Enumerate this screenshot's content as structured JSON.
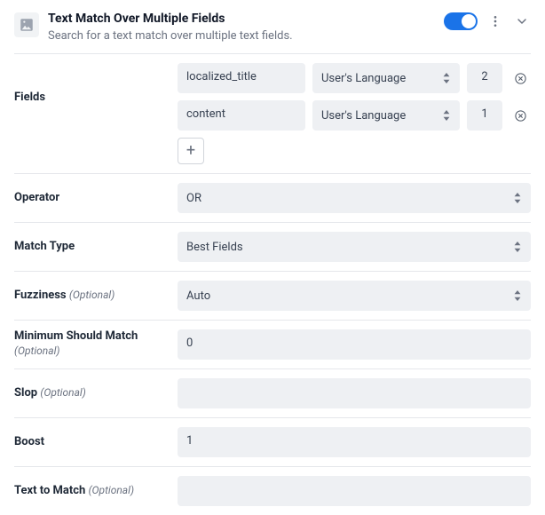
{
  "header": {
    "title": "Text Match Over Multiple Fields",
    "subtitle": "Search for a text match over multiple text fields."
  },
  "fields": {
    "label": "Fields",
    "rows": [
      {
        "name": "localized_title",
        "lang": "User's Language",
        "weight": "2"
      },
      {
        "name": "content",
        "lang": "User's Language",
        "weight": "1"
      }
    ]
  },
  "operator": {
    "label": "Operator",
    "value": "OR"
  },
  "match_type": {
    "label": "Match Type",
    "value": "Best Fields"
  },
  "fuzziness": {
    "label": "Fuzziness",
    "opt": "(Optional)",
    "value": "Auto"
  },
  "min_should": {
    "label": "Minimum Should Match",
    "opt": "(Optional)",
    "value": "0"
  },
  "slop": {
    "label": "Slop",
    "opt": "(Optional)",
    "value": ""
  },
  "boost": {
    "label": "Boost",
    "value": "1"
  },
  "text_to_match": {
    "label": "Text to Match",
    "opt": "(Optional)",
    "value": ""
  }
}
